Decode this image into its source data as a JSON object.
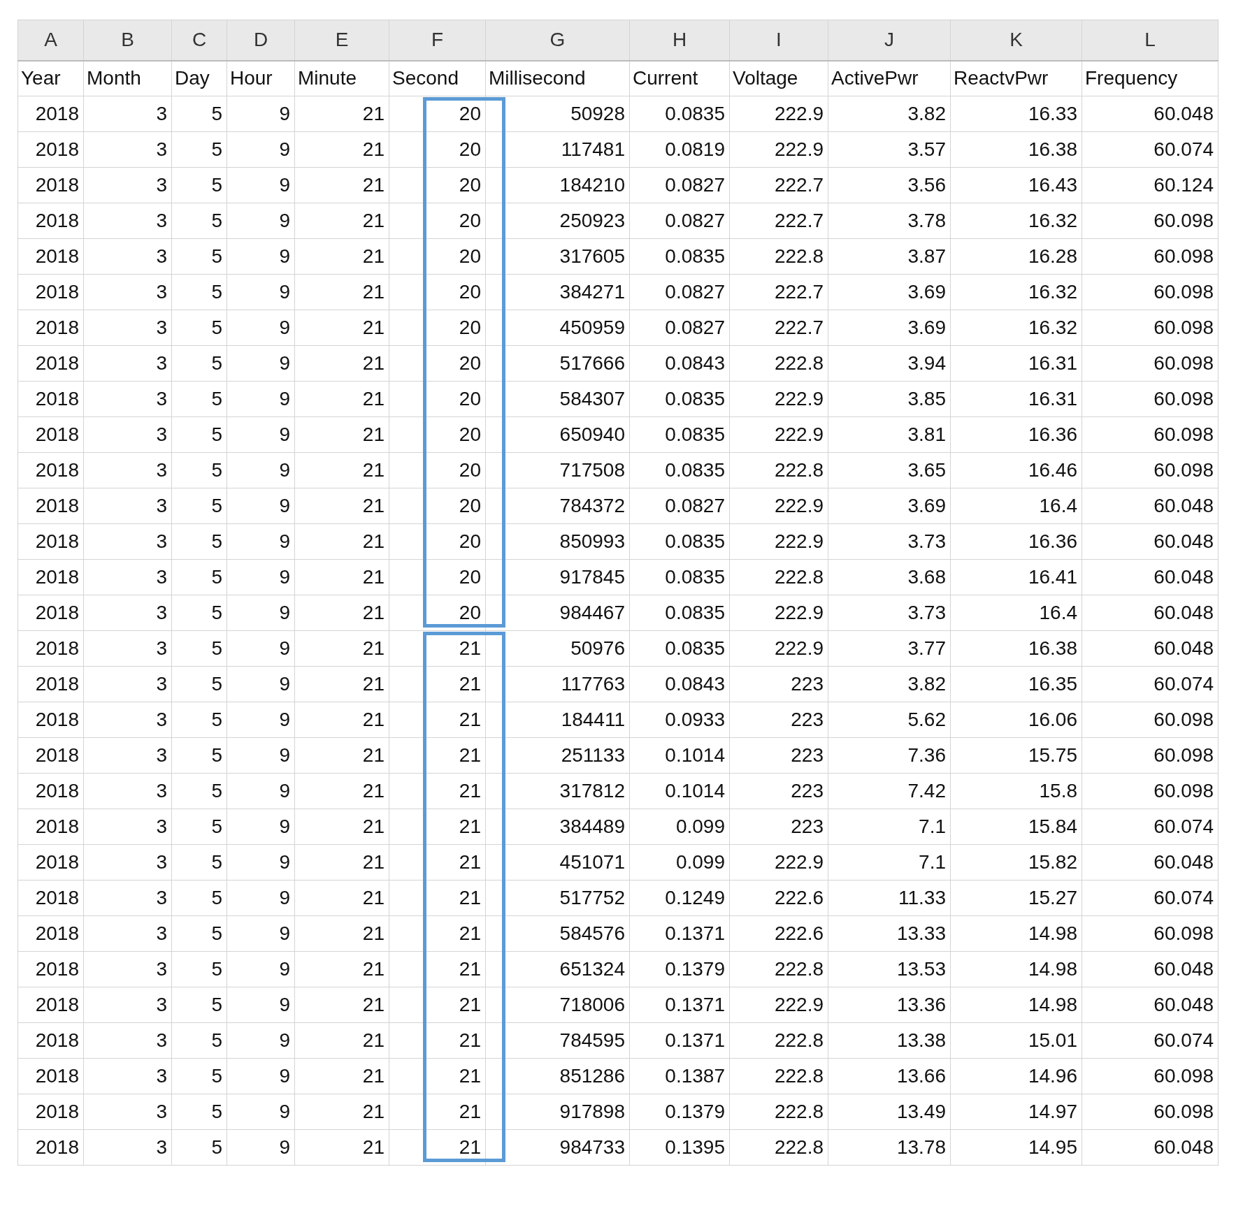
{
  "column_letters": [
    "A",
    "B",
    "C",
    "D",
    "E",
    "F",
    "G",
    "H",
    "I",
    "J",
    "K",
    "L"
  ],
  "header": [
    "Year",
    "Month",
    "Day",
    "Hour",
    "Minute",
    "Second",
    "Millisecond",
    "Current",
    "Voltage",
    "ActivePwr",
    "ReactvPwr",
    "Frequency"
  ],
  "row_groups": [
    {
      "boxed": true,
      "rows": [
        [
          "2018",
          "3",
          "5",
          "9",
          "21",
          "20",
          "50928",
          "0.0835",
          "222.9",
          "3.82",
          "16.33",
          "60.048"
        ],
        [
          "2018",
          "3",
          "5",
          "9",
          "21",
          "20",
          "117481",
          "0.0819",
          "222.9",
          "3.57",
          "16.38",
          "60.074"
        ],
        [
          "2018",
          "3",
          "5",
          "9",
          "21",
          "20",
          "184210",
          "0.0827",
          "222.7",
          "3.56",
          "16.43",
          "60.124"
        ],
        [
          "2018",
          "3",
          "5",
          "9",
          "21",
          "20",
          "250923",
          "0.0827",
          "222.7",
          "3.78",
          "16.32",
          "60.098"
        ],
        [
          "2018",
          "3",
          "5",
          "9",
          "21",
          "20",
          "317605",
          "0.0835",
          "222.8",
          "3.87",
          "16.28",
          "60.098"
        ],
        [
          "2018",
          "3",
          "5",
          "9",
          "21",
          "20",
          "384271",
          "0.0827",
          "222.7",
          "3.69",
          "16.32",
          "60.098"
        ],
        [
          "2018",
          "3",
          "5",
          "9",
          "21",
          "20",
          "450959",
          "0.0827",
          "222.7",
          "3.69",
          "16.32",
          "60.098"
        ],
        [
          "2018",
          "3",
          "5",
          "9",
          "21",
          "20",
          "517666",
          "0.0843",
          "222.8",
          "3.94",
          "16.31",
          "60.098"
        ],
        [
          "2018",
          "3",
          "5",
          "9",
          "21",
          "20",
          "584307",
          "0.0835",
          "222.9",
          "3.85",
          "16.31",
          "60.098"
        ],
        [
          "2018",
          "3",
          "5",
          "9",
          "21",
          "20",
          "650940",
          "0.0835",
          "222.9",
          "3.81",
          "16.36",
          "60.098"
        ],
        [
          "2018",
          "3",
          "5",
          "9",
          "21",
          "20",
          "717508",
          "0.0835",
          "222.8",
          "3.65",
          "16.46",
          "60.098"
        ],
        [
          "2018",
          "3",
          "5",
          "9",
          "21",
          "20",
          "784372",
          "0.0827",
          "222.9",
          "3.69",
          "16.4",
          "60.048"
        ],
        [
          "2018",
          "3",
          "5",
          "9",
          "21",
          "20",
          "850993",
          "0.0835",
          "222.9",
          "3.73",
          "16.36",
          "60.048"
        ],
        [
          "2018",
          "3",
          "5",
          "9",
          "21",
          "20",
          "917845",
          "0.0835",
          "222.8",
          "3.68",
          "16.41",
          "60.048"
        ],
        [
          "2018",
          "3",
          "5",
          "9",
          "21",
          "20",
          "984467",
          "0.0835",
          "222.9",
          "3.73",
          "16.4",
          "60.048"
        ]
      ]
    },
    {
      "boxed": true,
      "rows": [
        [
          "2018",
          "3",
          "5",
          "9",
          "21",
          "21",
          "50976",
          "0.0835",
          "222.9",
          "3.77",
          "16.38",
          "60.048"
        ],
        [
          "2018",
          "3",
          "5",
          "9",
          "21",
          "21",
          "117763",
          "0.0843",
          "223",
          "3.82",
          "16.35",
          "60.074"
        ],
        [
          "2018",
          "3",
          "5",
          "9",
          "21",
          "21",
          "184411",
          "0.0933",
          "223",
          "5.62",
          "16.06",
          "60.098"
        ],
        [
          "2018",
          "3",
          "5",
          "9",
          "21",
          "21",
          "251133",
          "0.1014",
          "223",
          "7.36",
          "15.75",
          "60.098"
        ],
        [
          "2018",
          "3",
          "5",
          "9",
          "21",
          "21",
          "317812",
          "0.1014",
          "223",
          "7.42",
          "15.8",
          "60.098"
        ],
        [
          "2018",
          "3",
          "5",
          "9",
          "21",
          "21",
          "384489",
          "0.099",
          "223",
          "7.1",
          "15.84",
          "60.074"
        ],
        [
          "2018",
          "3",
          "5",
          "9",
          "21",
          "21",
          "451071",
          "0.099",
          "222.9",
          "7.1",
          "15.82",
          "60.048"
        ],
        [
          "2018",
          "3",
          "5",
          "9",
          "21",
          "21",
          "517752",
          "0.1249",
          "222.6",
          "11.33",
          "15.27",
          "60.074"
        ],
        [
          "2018",
          "3",
          "5",
          "9",
          "21",
          "21",
          "584576",
          "0.1371",
          "222.6",
          "13.33",
          "14.98",
          "60.098"
        ],
        [
          "2018",
          "3",
          "5",
          "9",
          "21",
          "21",
          "651324",
          "0.1379",
          "222.8",
          "13.53",
          "14.98",
          "60.048"
        ],
        [
          "2018",
          "3",
          "5",
          "9",
          "21",
          "21",
          "718006",
          "0.1371",
          "222.9",
          "13.36",
          "14.98",
          "60.048"
        ],
        [
          "2018",
          "3",
          "5",
          "9",
          "21",
          "21",
          "784595",
          "0.1371",
          "222.8",
          "13.38",
          "15.01",
          "60.074"
        ],
        [
          "2018",
          "3",
          "5",
          "9",
          "21",
          "21",
          "851286",
          "0.1387",
          "222.8",
          "13.66",
          "14.96",
          "60.098"
        ],
        [
          "2018",
          "3",
          "5",
          "9",
          "21",
          "21",
          "917898",
          "0.1379",
          "222.8",
          "13.49",
          "14.97",
          "60.098"
        ],
        [
          "2018",
          "3",
          "5",
          "9",
          "21",
          "21",
          "984733",
          "0.1395",
          "222.8",
          "13.78",
          "14.95",
          "60.048"
        ]
      ]
    }
  ]
}
